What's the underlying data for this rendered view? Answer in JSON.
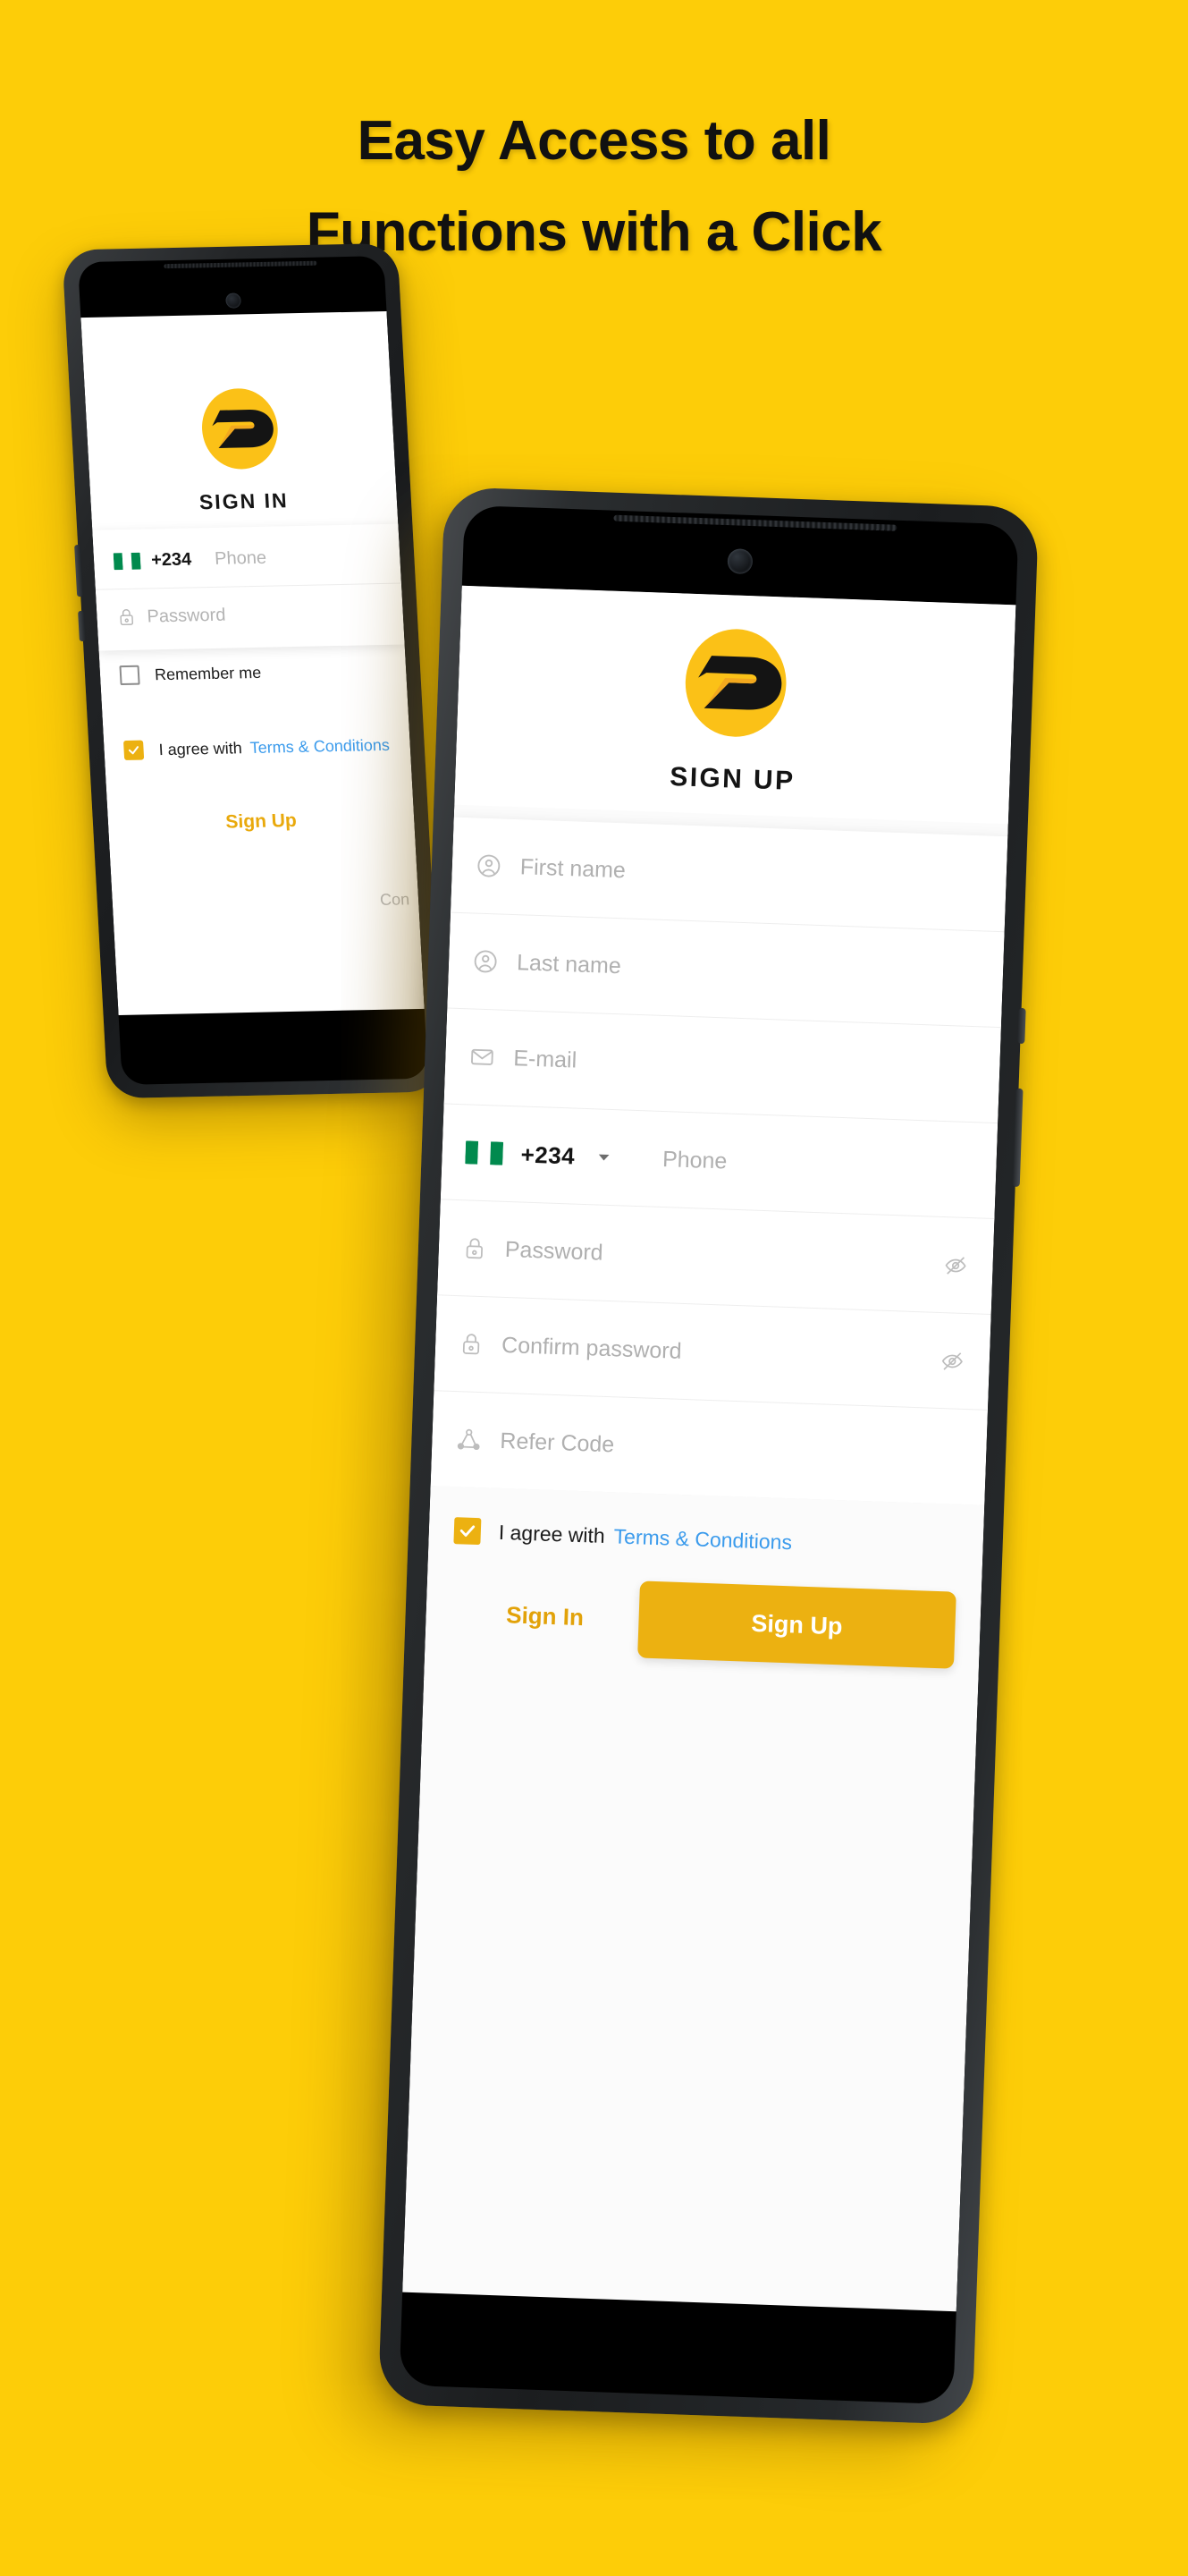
{
  "background_color": "#FDCD08",
  "brand": {
    "accent_yellow": "#ECB111",
    "logo_circle_color": "#FBC117",
    "logo_letter_color": "#141414",
    "logo_name": "brand-d-logo",
    "link_blue": "#3B9BEC",
    "flag_green": "#018A4E"
  },
  "headline": {
    "line1": "Easy Access to all",
    "line2": "Functions with a Click"
  },
  "back_phone": {
    "screen_title": "SIGN IN",
    "fields": [
      {
        "icon": "nigeria-flag-icon",
        "code": "+234",
        "placeholder": "Phone"
      },
      {
        "icon": "lock-icon",
        "placeholder": "Password"
      }
    ],
    "remember_me": {
      "label": "Remember me",
      "checked": false
    },
    "terms": {
      "prefix": "I agree with",
      "link": "Terms & Conditions",
      "checked": true
    },
    "signup_link": "Sign Up",
    "continue_text": "Con"
  },
  "front_phone": {
    "screen_title": "SIGN UP",
    "fields": [
      {
        "icon": "person-circle-icon",
        "placeholder": "First name"
      },
      {
        "icon": "person-circle-icon",
        "placeholder": "Last name"
      },
      {
        "icon": "envelope-icon",
        "placeholder": "E-mail"
      },
      {
        "icon": "nigeria-flag-icon",
        "code": "+234",
        "placeholder": "Phone",
        "has_caret": true
      },
      {
        "icon": "lock-icon",
        "placeholder": "Password",
        "trailing_icon": "eye-off-icon"
      },
      {
        "icon": "lock-icon",
        "placeholder": "Confirm password",
        "trailing_icon": "eye-off-icon"
      },
      {
        "icon": "referral-network-icon",
        "placeholder": "Refer Code"
      }
    ],
    "terms": {
      "prefix": "I agree with",
      "link": "Terms & Conditions",
      "checked": true
    },
    "sign_in_label": "Sign In",
    "sign_up_label": "Sign Up"
  }
}
